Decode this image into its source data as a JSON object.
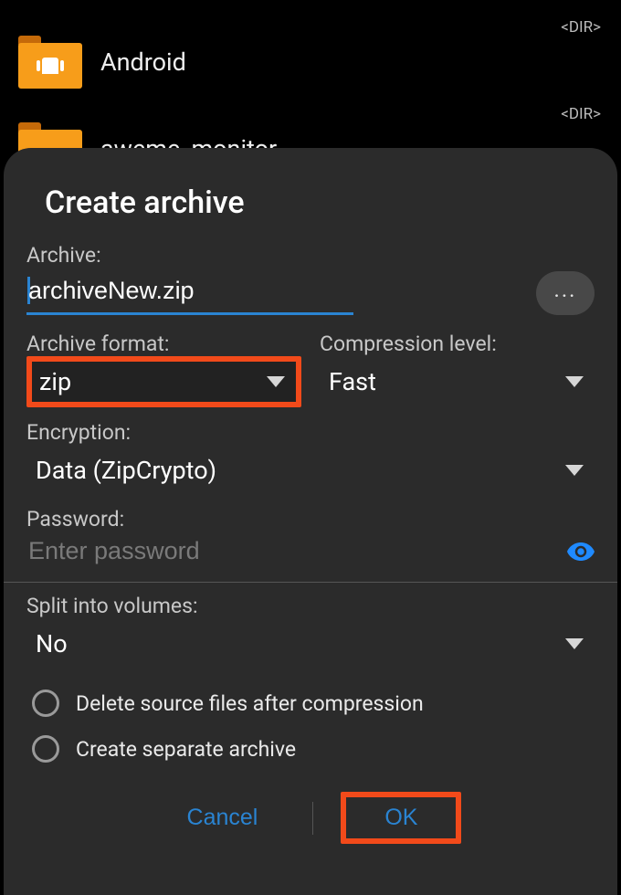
{
  "bg": {
    "items": [
      {
        "name": "Android",
        "dir": "<DIR>"
      },
      {
        "name": "aweme_monitor",
        "dir": "<DIR>"
      }
    ]
  },
  "dialog": {
    "title": "Create archive",
    "archive_label": "Archive:",
    "filename": "archiveNew.zip",
    "format_label": "Archive format:",
    "format_value": "zip",
    "compression_label": "Compression level:",
    "compression_value": "Fast",
    "encryption_label": "Encryption:",
    "encryption_value": "Data (ZipCrypto)",
    "password_label": "Password:",
    "password_placeholder": "Enter password",
    "split_label": "Split into volumes:",
    "split_value": "No",
    "delete_source_label": "Delete source files after compression",
    "separate_archive_label": "Create separate archive",
    "cancel_label": "Cancel",
    "ok_label": "OK",
    "browse_label": "..."
  }
}
